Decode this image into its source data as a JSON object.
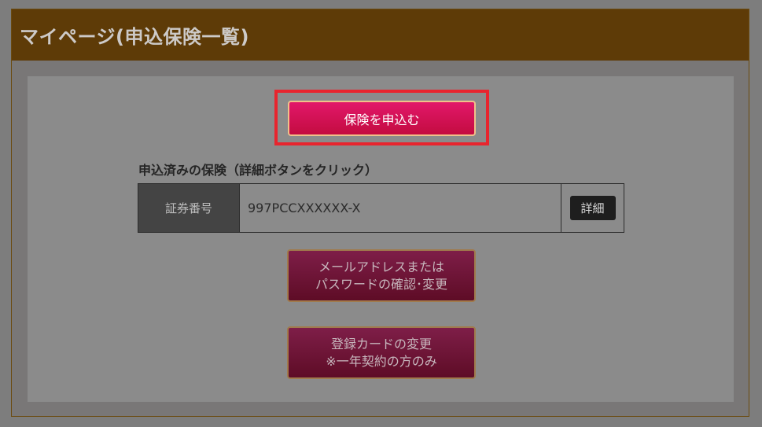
{
  "header": {
    "title": "マイページ(申込保険一覧)"
  },
  "main": {
    "apply_button_label": "保険を申込む",
    "section_label": "申込済みの保険（詳細ボタンをクリック）",
    "policy": {
      "head_label": "証券番号",
      "number": "997PCCXXXXXX-X",
      "detail_label": "詳細"
    },
    "mail_button": {
      "line1": "メールアドレスまたは",
      "line2": "パスワードの確認･変更"
    },
    "card_button": {
      "line1": "登録カードの変更",
      "line2": "※一年契約の方のみ"
    }
  },
  "colors": {
    "header_bg": "#5e3b07",
    "apply_button": "#e2176a",
    "highlight_border": "#e8252e"
  }
}
